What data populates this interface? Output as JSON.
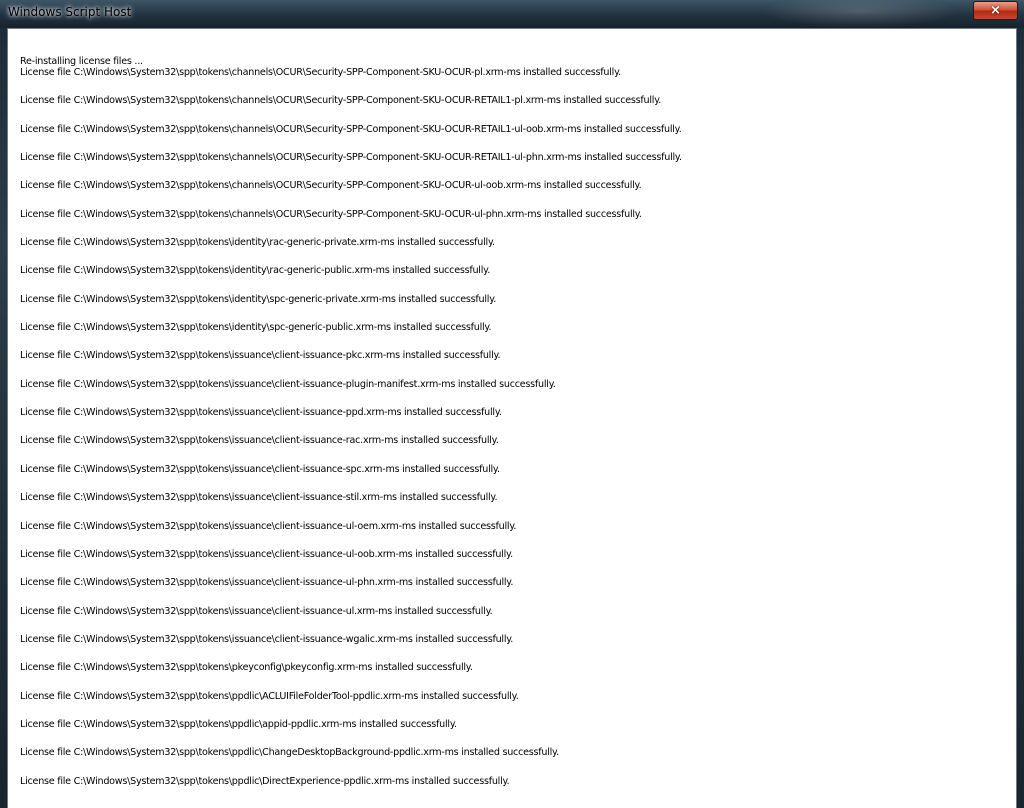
{
  "window": {
    "title": "Windows Script Host",
    "close_symbol": "×"
  },
  "output": {
    "heading": "Re-installing license files ...",
    "lines": [
      "License file C:\\Windows\\System32\\spp\\tokens\\channels\\OCUR\\Security-SPP-Component-SKU-OCUR-pl.xrm-ms installed successfully.",
      "License file C:\\Windows\\System32\\spp\\tokens\\channels\\OCUR\\Security-SPP-Component-SKU-OCUR-RETAIL1-pl.xrm-ms installed successfully.",
      "License file C:\\Windows\\System32\\spp\\tokens\\channels\\OCUR\\Security-SPP-Component-SKU-OCUR-RETAIL1-ul-oob.xrm-ms installed successfully.",
      "License file C:\\Windows\\System32\\spp\\tokens\\channels\\OCUR\\Security-SPP-Component-SKU-OCUR-RETAIL1-ul-phn.xrm-ms installed successfully.",
      "License file C:\\Windows\\System32\\spp\\tokens\\channels\\OCUR\\Security-SPP-Component-SKU-OCUR-ul-oob.xrm-ms installed successfully.",
      "License file C:\\Windows\\System32\\spp\\tokens\\channels\\OCUR\\Security-SPP-Component-SKU-OCUR-ul-phn.xrm-ms installed successfully.",
      "License file C:\\Windows\\System32\\spp\\tokens\\identity\\rac-generic-private.xrm-ms installed successfully.",
      "License file C:\\Windows\\System32\\spp\\tokens\\identity\\rac-generic-public.xrm-ms installed successfully.",
      "License file C:\\Windows\\System32\\spp\\tokens\\identity\\spc-generic-private.xrm-ms installed successfully.",
      "License file C:\\Windows\\System32\\spp\\tokens\\identity\\spc-generic-public.xrm-ms installed successfully.",
      "License file C:\\Windows\\System32\\spp\\tokens\\issuance\\client-issuance-pkc.xrm-ms installed successfully.",
      "License file C:\\Windows\\System32\\spp\\tokens\\issuance\\client-issuance-plugin-manifest.xrm-ms installed successfully.",
      "License file C:\\Windows\\System32\\spp\\tokens\\issuance\\client-issuance-ppd.xrm-ms installed successfully.",
      "License file C:\\Windows\\System32\\spp\\tokens\\issuance\\client-issuance-rac.xrm-ms installed successfully.",
      "License file C:\\Windows\\System32\\spp\\tokens\\issuance\\client-issuance-spc.xrm-ms installed successfully.",
      "License file C:\\Windows\\System32\\spp\\tokens\\issuance\\client-issuance-stil.xrm-ms installed successfully.",
      "License file C:\\Windows\\System32\\spp\\tokens\\issuance\\client-issuance-ul-oem.xrm-ms installed successfully.",
      "License file C:\\Windows\\System32\\spp\\tokens\\issuance\\client-issuance-ul-oob.xrm-ms installed successfully.",
      "License file C:\\Windows\\System32\\spp\\tokens\\issuance\\client-issuance-ul-phn.xrm-ms installed successfully.",
      "License file C:\\Windows\\System32\\spp\\tokens\\issuance\\client-issuance-ul.xrm-ms installed successfully.",
      "License file C:\\Windows\\System32\\spp\\tokens\\issuance\\client-issuance-wgalic.xrm-ms installed successfully.",
      "License file C:\\Windows\\System32\\spp\\tokens\\pkeyconfig\\pkeyconfig.xrm-ms installed successfully.",
      "License file C:\\Windows\\System32\\spp\\tokens\\ppdlic\\ACLUIFileFolderTool-ppdlic.xrm-ms installed successfully.",
      "License file C:\\Windows\\System32\\spp\\tokens\\ppdlic\\appid-ppdlic.xrm-ms installed successfully.",
      "License file C:\\Windows\\System32\\spp\\tokens\\ppdlic\\ChangeDesktopBackground-ppdlic.xrm-ms installed successfully.",
      "License file C:\\Windows\\System32\\spp\\tokens\\ppdlic\\DirectExperience-ppdlic.xrm-ms installed successfully."
    ]
  }
}
